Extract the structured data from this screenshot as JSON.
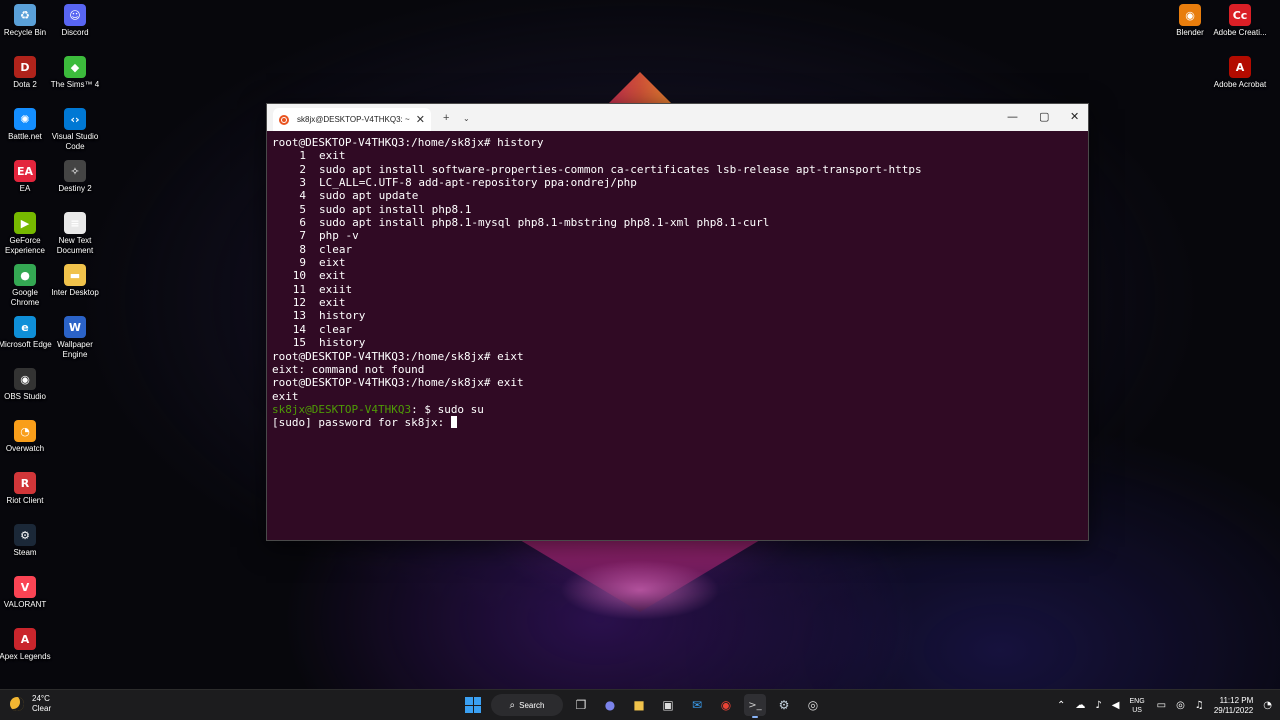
{
  "desktop": {
    "left_col1": [
      {
        "label": "Recycle Bin",
        "icon": "recycle-bin-icon",
        "glyph": "♻",
        "color": "#5aa0d8"
      },
      {
        "label": "Dota 2",
        "icon": "dota2-icon",
        "glyph": "D",
        "color": "#b0231b"
      },
      {
        "label": "Battle.net",
        "icon": "battlenet-icon",
        "glyph": "✺",
        "color": "#148eff"
      },
      {
        "label": "EA",
        "icon": "ea-icon",
        "glyph": "EA",
        "color": "#e3253d"
      },
      {
        "label": "GeForce Experience",
        "icon": "geforce-icon",
        "glyph": "▶",
        "color": "#76b900"
      },
      {
        "label": "Google Chrome",
        "icon": "chrome-icon",
        "glyph": "●",
        "color": "#34a853"
      },
      {
        "label": "Microsoft Edge",
        "icon": "edge-icon",
        "glyph": "e",
        "color": "#0f8fd8"
      },
      {
        "label": "OBS Studio",
        "icon": "obs-icon",
        "glyph": "◉",
        "color": "#333333"
      },
      {
        "label": "Overwatch",
        "icon": "overwatch-icon",
        "glyph": "◔",
        "color": "#f99e1a"
      },
      {
        "label": "Riot Client",
        "icon": "riot-client-icon",
        "glyph": "R",
        "color": "#d13639"
      },
      {
        "label": "Steam",
        "icon": "steam-icon",
        "glyph": "⚙",
        "color": "#1b2838"
      },
      {
        "label": "VALORANT",
        "icon": "valorant-icon",
        "glyph": "V",
        "color": "#fa4454"
      },
      {
        "label": "Apex Legends",
        "icon": "apex-icon",
        "glyph": "A",
        "color": "#c9252c"
      }
    ],
    "left_col2": [
      {
        "label": "Discord",
        "icon": "discord-icon",
        "glyph": "☺",
        "color": "#5865f2"
      },
      {
        "label": "The Sims™ 4",
        "icon": "sims4-icon",
        "glyph": "◆",
        "color": "#3cbb3c"
      },
      {
        "label": "Visual Studio Code",
        "icon": "vscode-icon",
        "glyph": "‹›",
        "color": "#0078d4"
      },
      {
        "label": "Destiny 2",
        "icon": "destiny2-icon",
        "glyph": "✧",
        "color": "#444444"
      },
      {
        "label": "New Text Document",
        "icon": "text-document-icon",
        "glyph": "≡",
        "color": "#e8e8e8"
      },
      {
        "label": "Inter Desktop",
        "icon": "folder-icon",
        "glyph": "▬",
        "color": "#f0c24b"
      },
      {
        "label": "Wallpaper Engine",
        "icon": "wallpaper-engine-icon",
        "glyph": "W",
        "color": "#2b63c8"
      }
    ],
    "right_col": [
      {
        "label": "Blender",
        "icon": "blender-icon",
        "glyph": "◉",
        "color": "#e87d0d"
      },
      {
        "label": "Adobe Creati...",
        "icon": "adobe-cc-icon",
        "glyph": "Cc",
        "color": "#da1f26"
      },
      {
        "label": "Adobe Acrobat",
        "icon": "adobe-acrobat-icon",
        "glyph": "A",
        "color": "#b30b00"
      }
    ]
  },
  "terminal": {
    "tab_title": "sk8jx@DESKTOP-V4THKQ3: ~",
    "tab_close": "✕",
    "new_tab": "+",
    "tab_dropdown": "⌄",
    "minimize": "—",
    "maximize": "▢",
    "close": "✕",
    "lines": {
      "l0": "root@DESKTOP-V4THKQ3:/home/sk8jx# history",
      "history": [
        {
          "n": "1",
          "cmd": "exit"
        },
        {
          "n": "2",
          "cmd": "sudo apt install software-properties-common ca-certificates lsb-release apt-transport-https"
        },
        {
          "n": "3",
          "cmd": "LC_ALL=C.UTF-8 add-apt-repository ppa:ondrej/php"
        },
        {
          "n": "4",
          "cmd": "sudo apt update"
        },
        {
          "n": "5",
          "cmd": "sudo apt install php8.1"
        },
        {
          "n": "6",
          "cmd": "sudo apt install php8.1-mysql php8.1-mbstring php8.1-xml php8.1-curl"
        },
        {
          "n": "7",
          "cmd": "php -v"
        },
        {
          "n": "8",
          "cmd": "clear"
        },
        {
          "n": "9",
          "cmd": "eixt"
        },
        {
          "n": "10",
          "cmd": "exit"
        },
        {
          "n": "11",
          "cmd": "exiit"
        },
        {
          "n": "12",
          "cmd": "exit"
        },
        {
          "n": "13",
          "cmd": "history"
        },
        {
          "n": "14",
          "cmd": "clear"
        },
        {
          "n": "15",
          "cmd": "history"
        }
      ],
      "l16": "root@DESKTOP-V4THKQ3:/home/sk8jx# eixt",
      "l17": "eixt: command not found",
      "l18": "root@DESKTOP-V4THKQ3:/home/sk8jx# exit",
      "l19": "exit",
      "l20_user": "sk8jx@DESKTOP-V4THKQ3",
      "l20_rest": ": $ sudo su",
      "l21": "[sudo] password for sk8jx: "
    }
  },
  "taskbar": {
    "weather_temp": "24°C",
    "weather_desc": "Clear",
    "search_label": "Search",
    "lang_top": "ENG",
    "lang_bottom": "US",
    "time": "11:12 PM",
    "date": "29/11/2022",
    "colors": {
      "accent": "#3aa0f3",
      "terminal_bg": "#300a24",
      "prompt_green": "#4e9a06"
    }
  }
}
